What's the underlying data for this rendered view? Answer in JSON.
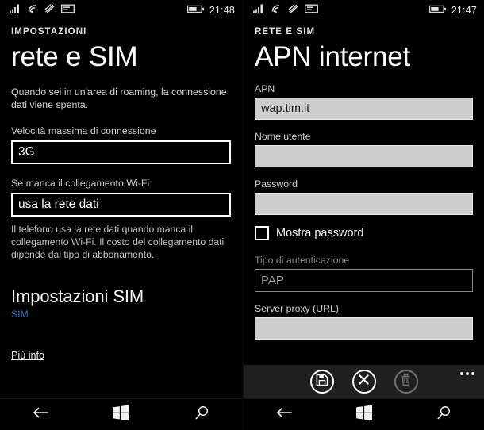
{
  "left": {
    "statusbar": {
      "icons": [
        "signal-bars-icon",
        "wifi-icon",
        "bluetooth-icon",
        "sim-card-icon"
      ],
      "battery": "battery-icon",
      "time": "21:48"
    },
    "breadcrumb": "IMPOSTAZIONI",
    "title": "rete e SIM",
    "roaming_note": "Quando sei in un'area di roaming, la connessione dati viene spenta.",
    "speed_label": "Velocità massima di connessione",
    "speed_value": "3G",
    "nowifi_label": "Se manca il collegamento Wi-Fi",
    "nowifi_value": "usa la rete dati",
    "nowifi_note": "Il telefono usa la rete dati quando manca il collegamento Wi-Fi. Il costo del collegamento dati dipende dal tipo di abbonamento.",
    "sim_section_title": "Impostazioni SIM",
    "sim_section_sub": "SIM",
    "sim_sub_color": "#2f7bc4",
    "more_info": "Più info",
    "nav": {
      "back": "back-icon",
      "home": "windows-home-icon",
      "search": "search-icon"
    }
  },
  "right": {
    "statusbar": {
      "icons": [
        "signal-bars-icon",
        "wifi-icon",
        "bluetooth-icon",
        "sim-card-icon"
      ],
      "battery": "battery-icon",
      "time": "21:47"
    },
    "breadcrumb": "RETE E SIM",
    "title": "APN internet",
    "fields": {
      "apn_label": "APN",
      "apn_value": "wap.tim.it",
      "username_label": "Nome utente",
      "username_value": "",
      "password_label": "Password",
      "password_value": "",
      "show_password_label": "Mostra password",
      "show_password_checked": false,
      "auth_label": "Tipo di autenticazione",
      "auth_value": "PAP",
      "proxy_label": "Server proxy (URL)",
      "proxy_value": ""
    },
    "appbar": {
      "save": "save-icon",
      "cancel": "cancel-icon",
      "delete": "trash-icon",
      "more": "more-ellipsis-icon"
    },
    "nav": {
      "back": "back-icon",
      "home": "windows-home-icon",
      "search": "search-icon"
    }
  }
}
